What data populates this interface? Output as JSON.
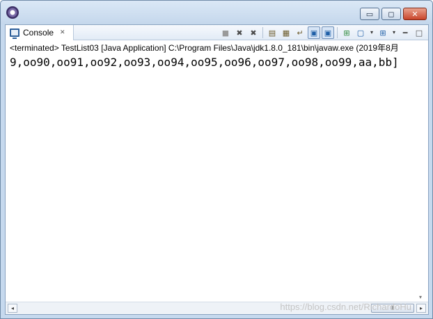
{
  "window": {
    "controls": {
      "minimize": "▭",
      "maximize": "◻",
      "close": "✕"
    }
  },
  "tab": {
    "label": "Console",
    "close_glyph": "✕",
    "icon": "console-icon"
  },
  "toolbar": {
    "icons": [
      "terminate-icon",
      "remove-launch-icon",
      "remove-all-terminated-icon",
      "clear-console-icon",
      "scroll-lock-icon",
      "word-wrap-icon",
      "show-on-stdout-icon",
      "show-on-stderr-icon",
      "pin-console-icon",
      "display-selected-console-icon",
      "open-console-icon",
      "minimize-view-icon",
      "maximize-view-icon"
    ],
    "glyphs": {
      "terminate": "■",
      "remove": "✖",
      "remove_all": "✖",
      "clear": "▤",
      "scroll_lock": "▦",
      "word_wrap": "↵",
      "stdout": "▣",
      "stderr": "▣",
      "pin": "⊞",
      "display": "▢",
      "dropdown": "▾",
      "open": "⊞",
      "minimize": "━",
      "maximize": "□"
    }
  },
  "console": {
    "status": "<terminated> TestList03 [Java Application] C:\\Program Files\\Java\\jdk1.8.0_181\\bin\\javaw.exe (2019年8月",
    "output": "9,oo90,oo91,oo92,oo93,oo94,oo95,oo96,oo97,oo98,oo99,aa,bb]"
  },
  "scrollbar": {
    "left": "◂",
    "right": "▸",
    "down": "▾",
    "thumb": "⦀"
  },
  "watermark": "https://blog.csdn.net/RichardoHu"
}
